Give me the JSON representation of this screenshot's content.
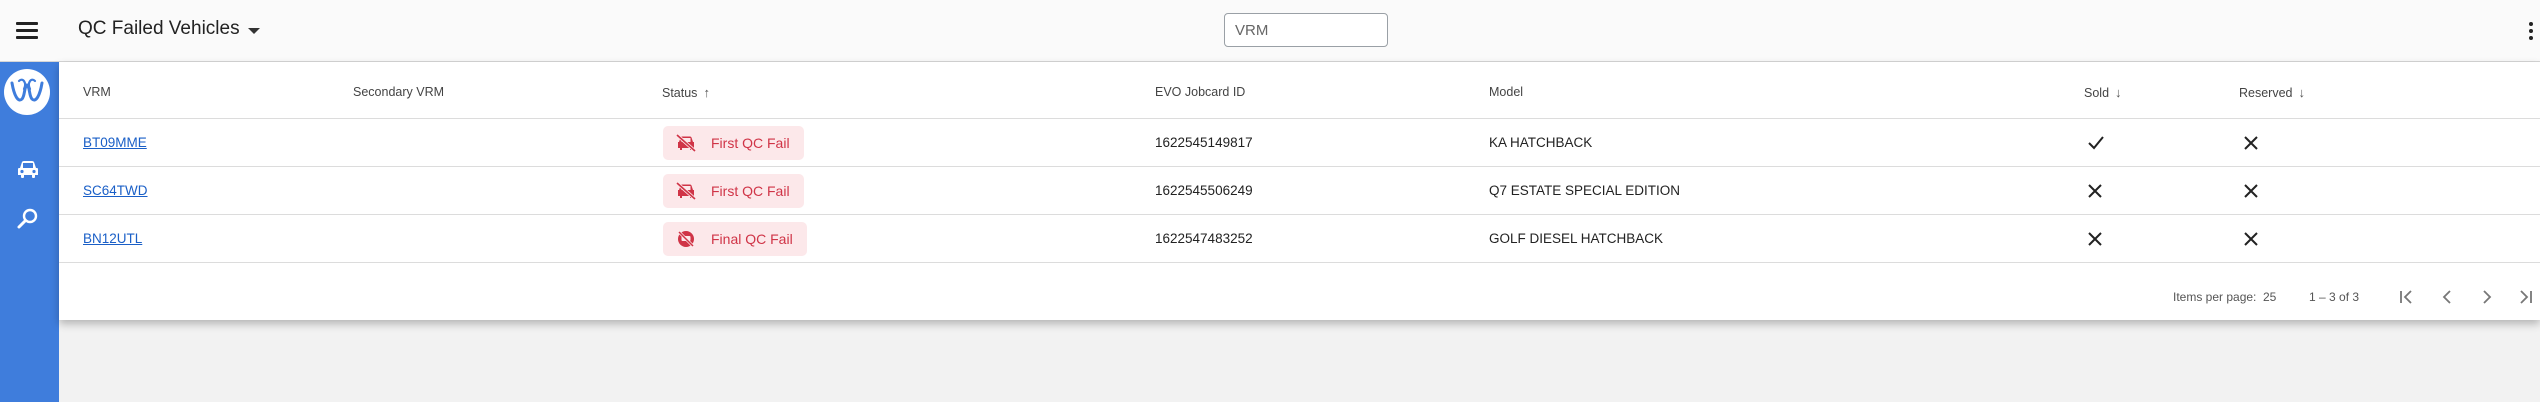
{
  "header": {
    "title": "QC Failed Vehicles",
    "search_placeholder": "VRM"
  },
  "table": {
    "columns": {
      "vrm": "VRM",
      "secondary_vrm": "Secondary VRM",
      "status": "Status",
      "evo_jobcard_id": "EVO Jobcard ID",
      "model": "Model",
      "sold": "Sold",
      "reserved": "Reserved"
    },
    "rows": [
      {
        "vrm": "BT09MME",
        "secondary_vrm": "",
        "status": "First QC Fail",
        "status_icon": "no-car-icon",
        "evo_jobcard_id": "1622545149817",
        "model": "KA HATCHBACK",
        "sold": "check",
        "reserved": "cross"
      },
      {
        "vrm": "SC64TWD",
        "secondary_vrm": "",
        "status": "First QC Fail",
        "status_icon": "no-car-icon",
        "evo_jobcard_id": "1622545506249",
        "model": "Q7 ESTATE SPECIAL EDITION",
        "sold": "cross",
        "reserved": "cross"
      },
      {
        "vrm": "BN12UTL",
        "secondary_vrm": "",
        "status": "Final QC Fail",
        "status_icon": "blocked-icon",
        "evo_jobcard_id": "1622547483252",
        "model": "GOLF DIESEL HATCHBACK",
        "sold": "cross",
        "reserved": "cross"
      }
    ]
  },
  "pagination": {
    "items_per_page_label": "Items per page:",
    "items_per_page_value": "25",
    "range": "1 – 3 of 3"
  },
  "colors": {
    "sidebar": "#3f7ddc",
    "link": "#1a5fc7",
    "status_bg": "#fce8ea",
    "status_text": "#d03447"
  }
}
